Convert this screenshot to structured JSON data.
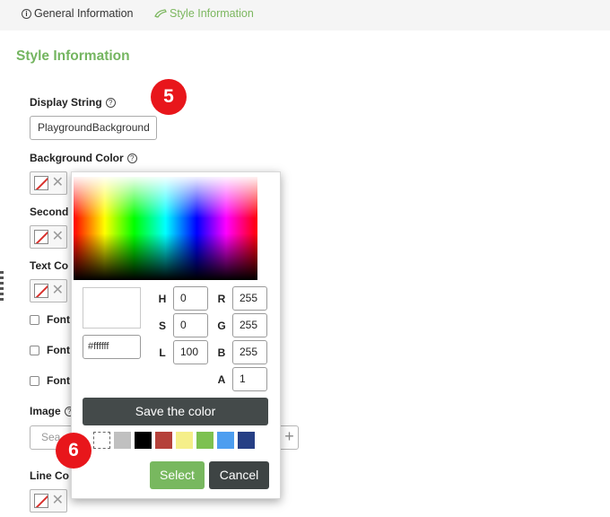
{
  "tabs": [
    {
      "label": "General Information",
      "icon": "info-circle-icon"
    },
    {
      "label": "Style Information",
      "icon": "brush-icon"
    }
  ],
  "section_title": "Style Information",
  "fields": {
    "display_string": {
      "label": "Display String",
      "value": "PlaygroundBackground"
    },
    "background_color": {
      "label": "Background Color"
    },
    "secondary_color": {
      "label": "Second"
    },
    "text_color": {
      "label": "Text Co"
    },
    "font_options": [
      {
        "label": "Font"
      },
      {
        "label": "Font"
      },
      {
        "label": "Font"
      }
    ],
    "image": {
      "label": "Image",
      "placeholder": "Sea"
    },
    "line_color": {
      "label": "Line Co"
    }
  },
  "badges": [
    "5",
    "6"
  ],
  "color_picker": {
    "hex": "#ffffff",
    "h_label": "H",
    "h": "0",
    "s_label": "S",
    "s": "0",
    "l_label": "L",
    "l": "100",
    "r_label": "R",
    "r": "255",
    "g_label": "G",
    "g": "255",
    "b_label": "B",
    "b": "255",
    "a_label": "A",
    "a": "1",
    "save_label": "Save the color",
    "palette": [
      "transparent",
      "#c0c0c0",
      "#000000",
      "#b5413a",
      "#f5ef8a",
      "#7dc150",
      "#4d9ef0",
      "#263f85"
    ],
    "select_label": "Select",
    "cancel_label": "Cancel"
  },
  "colors": {
    "accent": "#74b560",
    "badge": "#e8161b",
    "dark_button": "#444a4a"
  }
}
